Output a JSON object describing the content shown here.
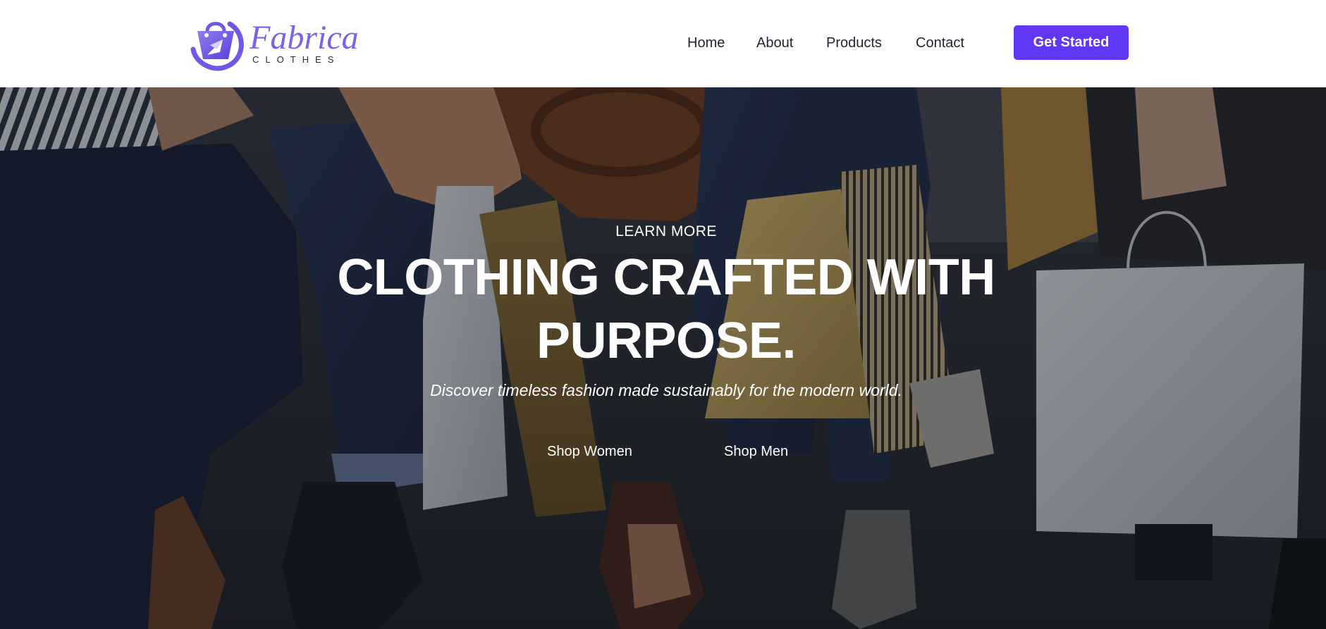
{
  "brand": {
    "name": "Fabrica",
    "tagline": "CLOTHES",
    "accent_color": "#6236f5",
    "logo_color": "#7b63e8"
  },
  "nav": {
    "items": [
      {
        "label": "Home"
      },
      {
        "label": "About"
      },
      {
        "label": "Products"
      },
      {
        "label": "Contact"
      }
    ],
    "cta_label": "Get Started"
  },
  "hero": {
    "eyebrow": "LEARN MORE",
    "headline": "CLOTHING CRAFTED WITH PURPOSE.",
    "subhead": "Discover timeless fashion made sustainably for the modern world.",
    "buttons": [
      {
        "label": "Shop Women"
      },
      {
        "label": "Shop Men"
      }
    ],
    "background_image": "dimmed-photo-people-seated-holding-shopping-bags"
  }
}
